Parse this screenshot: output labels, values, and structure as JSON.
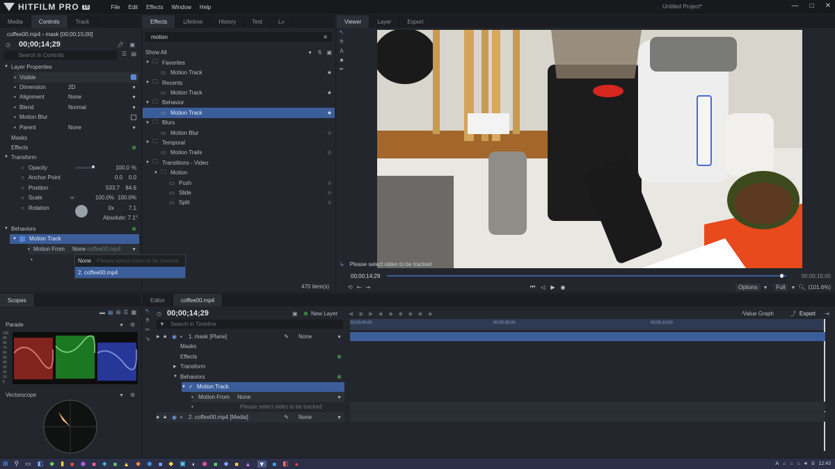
{
  "menubar": {
    "logo": "HITFILM PRO",
    "version": "15",
    "menus": [
      "File",
      "Edit",
      "Effects",
      "Window",
      "Help"
    ],
    "project_title": "Untitled Project*"
  },
  "left": {
    "tabs": [
      "Media",
      "Controls",
      "Track"
    ],
    "breadcrumb": "coffee00.mp4 › mask [00;00;15;00]",
    "timecode": "00;00;14;29",
    "search_placeholder": "Search in Controls",
    "layer_properties": "Layer Properties",
    "props": [
      {
        "label": "Visible",
        "value": ""
      },
      {
        "label": "Dimension",
        "value": "2D"
      },
      {
        "label": "Alignment",
        "value": "None"
      },
      {
        "label": "Blend",
        "value": "Normal"
      },
      {
        "label": "Motion Blur",
        "value": ""
      },
      {
        "label": "Parent",
        "value": "None"
      }
    ],
    "masks": "Masks",
    "effects": "Effects",
    "transform": "Transform",
    "transform_props": [
      {
        "label": "Opacity",
        "v1": "100.0",
        "v2": "%"
      },
      {
        "label": "Anchor Point",
        "v1": "0.0",
        "v2": "0.0"
      },
      {
        "label": "Position",
        "v1": "533.7",
        "v2": "84.6"
      },
      {
        "label": "Scale",
        "v1": "100.0%",
        "v2": "100.0%"
      },
      {
        "label": "Rotation",
        "v1": "0x",
        "v2": "7.1"
      }
    ],
    "absolute": "Absolute: 7.1°",
    "behaviors": "Behaviors",
    "motion_track": "Motion Track",
    "motion_from": "Motion From",
    "motion_from_value": "None",
    "motion_from_ghost": "coffee00.mp4",
    "ghost_hint": "Please select video to be tracked",
    "dropdown_options": [
      "None",
      "2. coffee00.mp4"
    ]
  },
  "effects": {
    "tabs": [
      "Effects",
      "Lifetime",
      "History",
      "Text",
      "L»"
    ],
    "search": "motion",
    "filter": "Show All",
    "tree": [
      {
        "label": "Favorites",
        "level": 0,
        "folder": true
      },
      {
        "label": "Motion Track",
        "level": 1,
        "star": true,
        "filled": true
      },
      {
        "label": "Recents",
        "level": 0,
        "folder": true
      },
      {
        "label": "Motion Track",
        "level": 1,
        "star": true,
        "filled": true
      },
      {
        "label": "Behavior",
        "level": 0,
        "folder": true
      },
      {
        "label": "Motion Track",
        "level": 1,
        "star": true,
        "filled": true,
        "selected": true
      },
      {
        "label": "Blurs",
        "level": 0,
        "folder": true
      },
      {
        "label": "Motion Blur",
        "level": 1,
        "star": true
      },
      {
        "label": "Temporal",
        "level": 0,
        "folder": true
      },
      {
        "label": "Motion Trails",
        "level": 1,
        "star": true
      },
      {
        "label": "Transitions - Video",
        "level": 0,
        "folder": true
      },
      {
        "label": "Motion",
        "level": 1,
        "folder": true
      },
      {
        "label": "Push",
        "level": 2,
        "star": true
      },
      {
        "label": "Slide",
        "level": 2,
        "star": true
      },
      {
        "label": "Split",
        "level": 2,
        "star": true
      }
    ],
    "count": "470 item(s)"
  },
  "viewer": {
    "tabs": [
      "Viewer",
      "Layer",
      "Export"
    ],
    "status": "Please select video to be tracked",
    "timecode_current": "00;00;14;29",
    "timecode_end": "00;00;15;00",
    "playhead_fraction": 0.985,
    "options": "Options",
    "full": "Full",
    "zoom": "(101.6%)"
  },
  "scopes": {
    "tab": "Scopes",
    "parade": "Parade",
    "vectorscope": "Vectorscope",
    "scale": [
      "100",
      "90",
      "80",
      "70",
      "60",
      "50",
      "40",
      "30",
      "20",
      "10",
      "0"
    ]
  },
  "editor": {
    "tabs": [
      "Editor",
      "coffee00.mp4"
    ],
    "timecode": "00;00;14;29",
    "new_layer": "New Layer",
    "search_placeholder": "Search in Timeline",
    "value_graph": "Value Graph",
    "export": "Export",
    "ruler": [
      "00;00;00;00",
      "00;00;05;00",
      "00;00;10;00"
    ],
    "rows": [
      {
        "label": "1. mask [Plane]",
        "value": "None",
        "kind": "layer"
      },
      {
        "label": "Masks",
        "kind": "group"
      },
      {
        "label": "Effects",
        "kind": "group",
        "add": true
      },
      {
        "label": "Transform",
        "kind": "group",
        "arrow": "▶"
      },
      {
        "label": "Behaviors",
        "kind": "group",
        "arrow": "▼",
        "add": true
      },
      {
        "label": "Motion Track",
        "kind": "behavior"
      },
      {
        "label": "Motion From",
        "value": "None",
        "kind": "prop"
      },
      {
        "label": "Please select video to be tracked",
        "kind": "hint"
      },
      {
        "label": "2. coffee00.mp4 [Media]",
        "value": "None",
        "kind": "layer"
      }
    ]
  },
  "taskbar": {
    "lang": "A",
    "time": "12:43"
  }
}
